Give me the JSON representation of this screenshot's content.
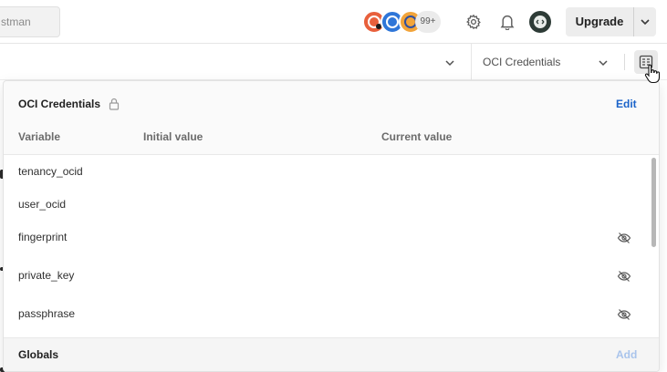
{
  "header": {
    "search_placeholder": "stman",
    "collaborators_more": "99+",
    "upgrade_label": "Upgrade"
  },
  "subbar": {
    "environment_selected": "OCI Credentials"
  },
  "environment_popover": {
    "title": "OCI Credentials",
    "edit_label": "Edit",
    "columns": {
      "variable": "Variable",
      "initial": "Initial value",
      "current": "Current value"
    },
    "rows": [
      {
        "variable": "tenancy_ocid",
        "initial": "",
        "current": "",
        "masked": false
      },
      {
        "variable": "user_ocid",
        "initial": "",
        "current": "",
        "masked": false
      },
      {
        "variable": "fingerprint",
        "initial": "",
        "current": "",
        "masked": true
      },
      {
        "variable": "private_key",
        "initial": "",
        "current": "",
        "masked": true
      },
      {
        "variable": "passphrase",
        "initial": "",
        "current": "",
        "masked": true
      }
    ],
    "globals_label": "Globals",
    "add_label": "Add"
  },
  "colors": {
    "link_blue": "#1b63c9",
    "disabled_blue": "#a9c4ec",
    "avatar_orange": "#e8603c",
    "avatar_blue": "#2f76d8",
    "avatar_yellow": "#f2a43a"
  },
  "icons": [
    "gear-icon",
    "bell-icon",
    "chevron-down-icon",
    "lock-icon",
    "eye-off-icon",
    "quick-look-icon",
    "hand-pointer-cursor-icon"
  ]
}
